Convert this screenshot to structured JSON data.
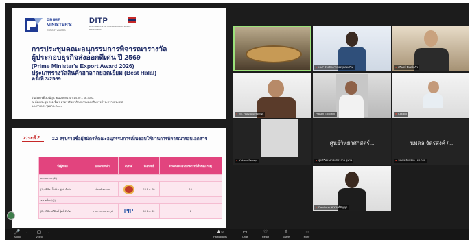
{
  "slide1": {
    "logo_pm_lines": [
      "PRIME",
      "MINISTER'S",
      "EXPORT AWARD"
    ],
    "logo_ditp": "DITP",
    "logo_ditp_sub": "DEPARTMENT OF INTERNATIONAL TRADE PROMOTION",
    "title_line1": "การประชุมคณะอนุกรรมการพิจารณารางวัล",
    "title_line2": "ผู้ประกอบธุรกิจส่งออกดีเด่น ปี 2569",
    "title_line3": "(Prime Minister's Export Award 2026)",
    "title_line4": "ประเภทรางวัลสินค้าฮาลาลยอดเยี่ยม (Best Halal)",
    "title_line5": "ครั้งที่ 3/2569",
    "info_line1": "วันอังคารที่ 30 มิถุนายน 2569 เวลา 14.00 – 16.30 น.",
    "info_line2": "ณ ห้องประชุม 701 ชั้น 7 อาคารรัชดาภิเษก กรมส่งเสริมการค้าระหว่างประเทศ",
    "info_line3": "และการประชุมผ่าน Zoom"
  },
  "slide2": {
    "agenda_tag": "วาระที่ 2",
    "heading": "2.2 สรุปรายชื่อผู้สมัครที่คณะอนุกรรมการเห็นชอบให้ผ่านการพิจารณารอบเอกสาร",
    "columns": [
      "ชื่อผู้สมัคร",
      "ประเภทสินค้า",
      "แบรนด์",
      "มีเอกสิทธิ์",
      "จำนวนคณะอนุกรรมการที่เห็นชอบ (ราย)"
    ],
    "section_m": "ขนาดกลาง (M)",
    "section_l": "ขนาดใหญ่ (L)",
    "row1": {
      "name": "(1) บริษัท เอ็นพีเอ ฟูดส์ จำกัด",
      "type": "เส้นหมี่ฮาลาล",
      "brand": "",
      "priv": "10 มิ.ย. 69",
      "count": "10"
    },
    "row2": {
      "name": "(2) บริษัท พรีมิเอร์ฟู้ดส์ จำกัด",
      "type": "อาหารทะเลแปรรูป",
      "brand": "PfP",
      "priv": "10 มิ.ย. 69",
      "count": "6"
    }
  },
  "participants": [
    {
      "caption": "",
      "speaking": true
    },
    {
      "caption": "KUP ฝ่ายจัดการกองทุนส่งเสริม",
      "speaking": false
    },
    {
      "caption": "ศิริพงษ์ อินทร์แก้ว",
      "speaking": false
    },
    {
      "caption": "ดร.วรวุฒิ บุญยรัตพันธุ์",
      "speaking": false
    },
    {
      "caption": "Prasan Exporting",
      "speaking": false
    },
    {
      "caption": "Kirkado",
      "speaking": false
    },
    {
      "caption": "Kirkado Senaya",
      "speaking": false
    },
    {
      "caption": "ศูนย์วิทยาศาสตร์ฮาลาล จุฬาฯ",
      "bigname": "ศูนย์วิทยาศาสตร์...",
      "speaking": false
    },
    {
      "caption": "นพดล จัดรสงค์ / ผอ.กรม",
      "bigname": "นพดล จัดรสงค์ /...",
      "speaking": false
    },
    {
      "caption": "Ratchana แสนวงศ์ปัญญา",
      "speaking": false
    }
  ],
  "toolbar": {
    "audio": "Audio",
    "video": "Video",
    "participants": "Participants",
    "participants_count": "10",
    "chat": "Chat",
    "react": "React",
    "share": "Share",
    "more": "More"
  }
}
